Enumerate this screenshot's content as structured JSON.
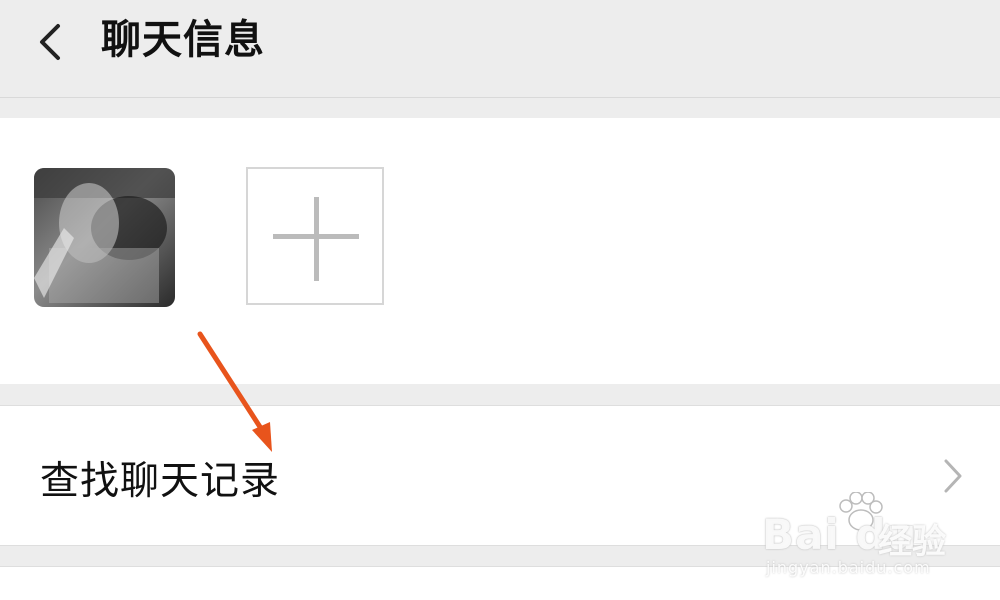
{
  "header": {
    "title": "聊天信息",
    "back_icon": "chevron-left-icon"
  },
  "members": {
    "avatar_icon": "avatar-image",
    "add_icon": "plus-icon"
  },
  "actions": {
    "search_history_label": "查找聊天记录",
    "chevron_icon": "chevron-right-icon"
  },
  "annotation": {
    "arrow_color": "#e8541c"
  },
  "watermark": {
    "logo": "Bai du",
    "cn": "经验",
    "url": "jingyan.baidu.com"
  },
  "colors": {
    "background": "#ededed",
    "card": "#ffffff",
    "text": "#111111",
    "plus": "#bbbbbb"
  }
}
